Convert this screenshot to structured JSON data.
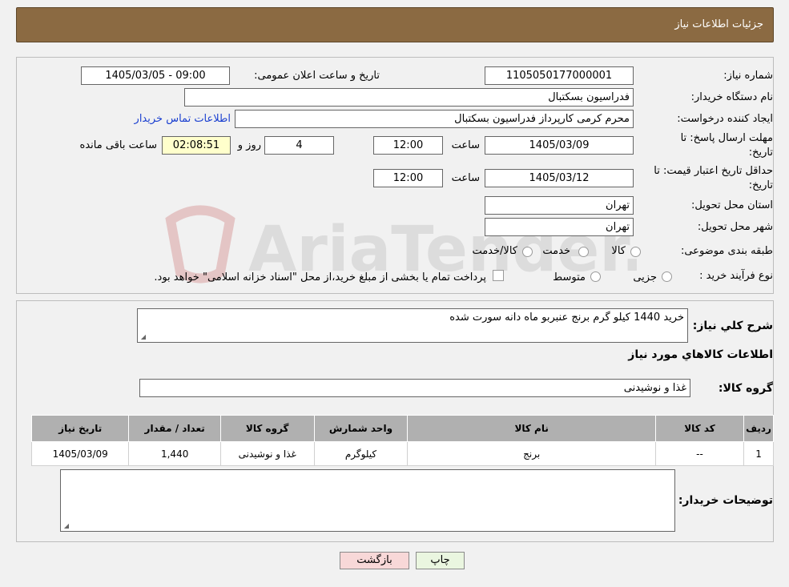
{
  "header": {
    "title": "جزئیات اطلاعات نیاز"
  },
  "form": {
    "need_number": {
      "label": "شماره نیاز:",
      "value": "1105050177000001"
    },
    "announce_datetime": {
      "label": "تاریخ و ساعت اعلان عمومی:",
      "value": "1405/03/05 - 09:00"
    },
    "buyer_org": {
      "label": "نام دستگاه خریدار:",
      "value": "فدراسیون بسکتبال"
    },
    "requester": {
      "label": "ایجاد کننده درخواست:",
      "value": "محرم کرمی کارپرداز فدراسیون بسکتبال",
      "contact_link": "اطلاعات تماس خریدار"
    },
    "deadline": {
      "label_line1": "مهلت ارسال پاسخ: تا",
      "label_line2": "تاریخ:",
      "date": "1405/03/09",
      "time_label": "ساعت",
      "time": "12:00",
      "days": "4",
      "days_label": "روز و",
      "remaining": "02:08:51",
      "remaining_label": "ساعت باقی مانده"
    },
    "price_validity": {
      "label_line1": "حداقل تاریخ اعتبار قیمت: تا",
      "label_line2": "تاریخ:",
      "date": "1405/03/12",
      "time_label": "ساعت",
      "time": "12:00"
    },
    "delivery_province": {
      "label": "استان محل تحویل:",
      "value": "تهران"
    },
    "delivery_city": {
      "label": "شهر محل تحویل:",
      "value": "تهران"
    },
    "category": {
      "label": "طبقه بندی موضوعی:",
      "options": [
        "کالا",
        "خدمت",
        "کالا/خدمت"
      ]
    },
    "purchase_process": {
      "label": "نوع فرآیند خرید :",
      "options": [
        "جزیی",
        "متوسط"
      ],
      "note": "پرداخت تمام یا بخشی از مبلغ خرید،از محل \"اسناد خزانه اسلامی\" خواهد بود."
    }
  },
  "details": {
    "summary_label": "شرح کلي نياز:",
    "summary_value": "خرید 1440 کیلو گرم برنج عنبربو ماه دانه سورت شده",
    "goods_info_title": "اطلاعات کالاهاي مورد نياز",
    "goods_group_label": "گروه کالا:",
    "goods_group_value": "غذا و نوشیدنی",
    "table": {
      "headers": [
        "ردیف",
        "کد کالا",
        "نام کالا",
        "واحد شمارش",
        "گروه کالا",
        "تعداد / مقدار",
        "تاریخ نیاز"
      ],
      "rows": [
        [
          "1",
          "--",
          "برنج",
          "کیلوگرم",
          "غذا و نوشیدنی",
          "1,440",
          "1405/03/09"
        ]
      ]
    },
    "buyer_notes_label": "توضیحات خریدار:",
    "buyer_notes_value": ""
  },
  "buttons": {
    "print": "چاپ",
    "back": "بازگشت"
  },
  "watermark": {
    "brand": "AriaTender.neT"
  },
  "colors": {
    "header_bg": "#8b6a42",
    "table_header_bg": "#b0b0b0",
    "link": "#1a3fd0",
    "back_btn": "#f8d8d8",
    "print_btn": "#eaf6e0"
  }
}
